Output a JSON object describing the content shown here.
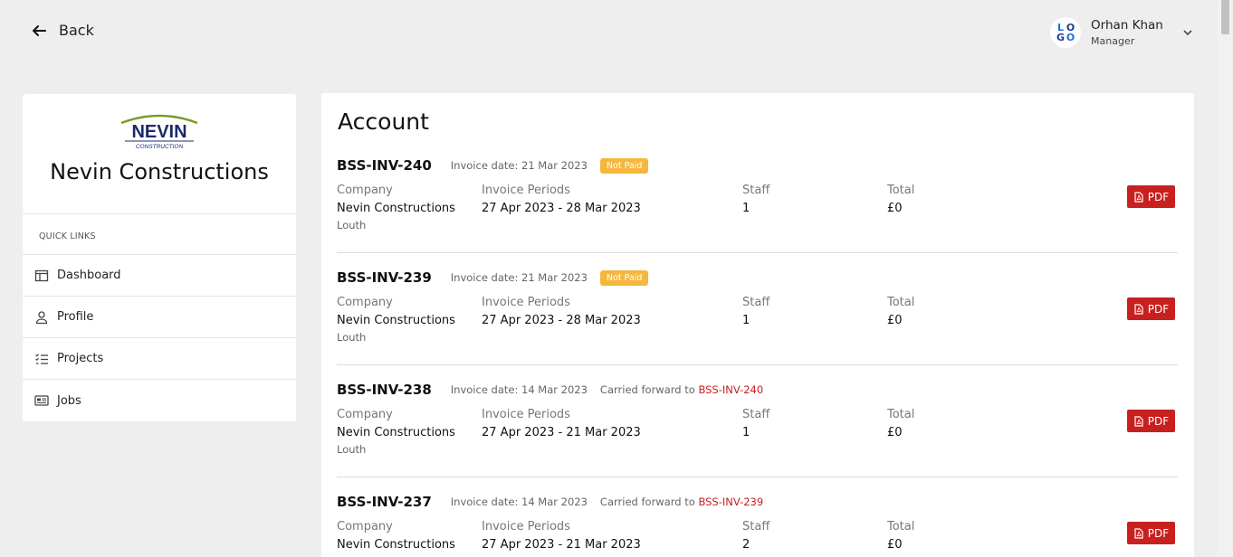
{
  "header": {
    "back_label": "Back",
    "user": {
      "name": "Orhan Khan",
      "role": "Manager",
      "avatar_letters": [
        "L",
        "O",
        "G",
        "O"
      ]
    }
  },
  "sidebar": {
    "logo_text": "NEVIN",
    "logo_subtext": "CONSTRUCTION",
    "company_name": "Nevin Constructions",
    "quick_links_title": "QUICK LINKS",
    "items": [
      {
        "label": "Dashboard",
        "icon": "dashboard-icon"
      },
      {
        "label": "Profile",
        "icon": "user-icon"
      },
      {
        "label": "Projects",
        "icon": "checklist-icon"
      },
      {
        "label": "Jobs",
        "icon": "jobs-icon"
      }
    ]
  },
  "main": {
    "title": "Account",
    "columns": {
      "company": "Company",
      "periods": "Invoice Periods",
      "staff": "Staff",
      "total": "Total"
    },
    "pdf_label": "PDF",
    "invoices": [
      {
        "id": "BSS-INV-240",
        "date": "Invoice date: 21 Mar 2023",
        "status": "Not Paid",
        "carried_text": "",
        "carried_ref": "",
        "company": "Nevin Constructions",
        "location": "Louth",
        "period": "27 Apr 2023 - 28 Mar 2023",
        "staff": "1",
        "total": "£0"
      },
      {
        "id": "BSS-INV-239",
        "date": "Invoice date: 21 Mar 2023",
        "status": "Not Paid",
        "carried_text": "",
        "carried_ref": "",
        "company": "Nevin Constructions",
        "location": "Louth",
        "period": "27 Apr 2023 - 28 Mar 2023",
        "staff": "1",
        "total": "£0"
      },
      {
        "id": "BSS-INV-238",
        "date": "Invoice date: 14 Mar 2023",
        "status": "",
        "carried_text": "Carried forward to ",
        "carried_ref": "BSS-INV-240",
        "company": "Nevin Constructions",
        "location": "Louth",
        "period": "27 Apr 2023 - 21 Mar 2023",
        "staff": "1",
        "total": "£0"
      },
      {
        "id": "BSS-INV-237",
        "date": "Invoice date: 14 Mar 2023",
        "status": "",
        "carried_text": "Carried forward to ",
        "carried_ref": "BSS-INV-239",
        "company": "Nevin Constructions",
        "location": "",
        "period": "27 Apr 2023 - 21 Mar 2023",
        "staff": "2",
        "total": "£0"
      }
    ]
  },
  "colors": {
    "accent_red": "#c8201f",
    "badge_yellow": "#f6b73c",
    "background": "#eeeeee"
  }
}
